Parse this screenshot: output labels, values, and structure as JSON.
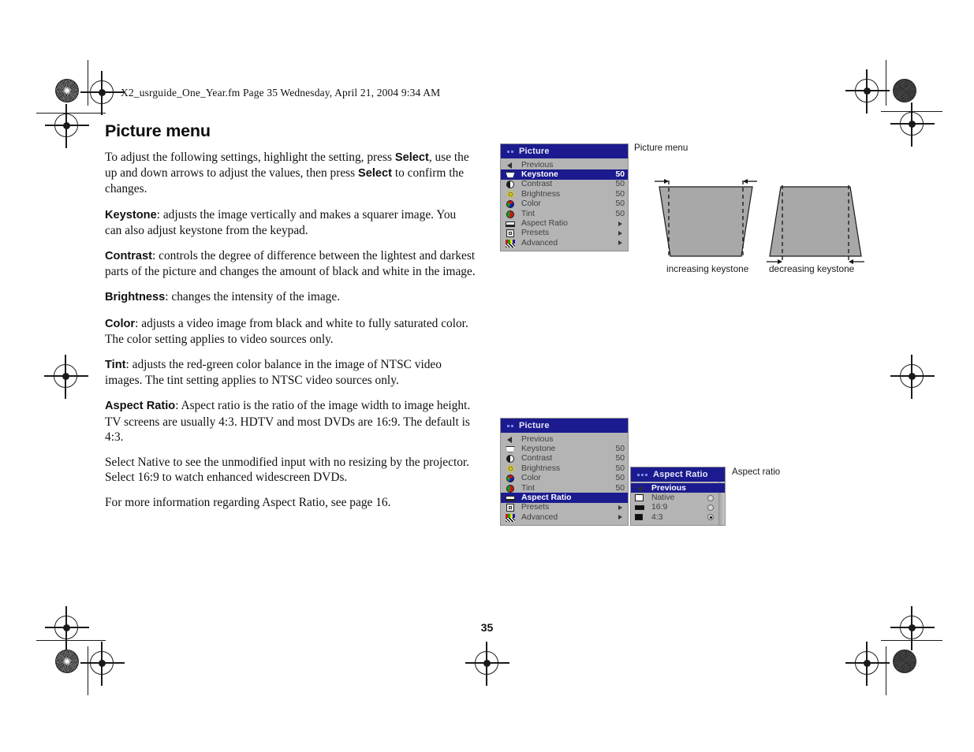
{
  "document": {
    "header_line": "X2_usrguide_One_Year.fm  Page 35  Wednesday, April 21, 2004  9:34 AM",
    "page_number": "35"
  },
  "content": {
    "title": "Picture menu",
    "paragraphs": [
      {
        "lead": "",
        "text": "To adjust the following settings, highlight the setting, press Select, use the up and down arrows to adjust the values, then press Select to confirm the changes."
      },
      {
        "lead": "Keystone",
        "text": ": adjusts the image vertically and makes a squarer image. You can also adjust keystone from the keypad."
      },
      {
        "lead": "Contrast",
        "text": ": controls the degree of difference between the lightest and darkest parts of the picture and changes the amount of black and white in the image."
      },
      {
        "lead": "Brightness",
        "text": ": changes the intensity of the image."
      },
      {
        "lead": "Color",
        "text": ": adjusts a video image from black and white to fully saturated color. The color setting applies to video sources only."
      },
      {
        "lead": "Tint",
        "text": ": adjusts the red-green color balance in the image of NTSC video images. The tint setting applies to NTSC video sources only."
      },
      {
        "lead": "Aspect Ratio",
        "text": ": Aspect ratio is the ratio of the image width to image height. TV screens are usually 4:3. HDTV and most DVDs are 16:9. The default is 4:3."
      },
      {
        "lead": "",
        "text": "Select Native to see the unmodified input with no resizing by the projector. Select 16:9 to watch enhanced widescreen DVDs."
      },
      {
        "lead": "",
        "text": "For more information regarding Aspect Ratio, see page 16."
      }
    ],
    "bold_words_p1": [
      "Select",
      "Select"
    ]
  },
  "colors": {
    "menu_titlebar": "#1b1b8f",
    "menu_background": "#b4b4b4",
    "menu_highlight": "#1b1b8f",
    "menu_text": "#404040",
    "menu_text_selected": "#ffffff",
    "figure_fill": "#a8a8a8",
    "figure_stroke": "#1a1a1a"
  },
  "menu_picture_top": {
    "title": "Picture",
    "rows": [
      {
        "label": "Previous",
        "icon": "previous-arrow-icon",
        "value": "",
        "submenu": false,
        "selected": false
      },
      {
        "label": "Keystone",
        "icon": "keystone-icon",
        "value": "50",
        "submenu": false,
        "selected": true
      },
      {
        "label": "Contrast",
        "icon": "contrast-icon",
        "value": "50",
        "submenu": false,
        "selected": false
      },
      {
        "label": "Brightness",
        "icon": "brightness-icon",
        "value": "50",
        "submenu": false,
        "selected": false
      },
      {
        "label": "Color",
        "icon": "color-icon",
        "value": "50",
        "submenu": false,
        "selected": false
      },
      {
        "label": "Tint",
        "icon": "tint-icon",
        "value": "50",
        "submenu": false,
        "selected": false
      },
      {
        "label": "Aspect Ratio",
        "icon": "aspect-ratio-icon",
        "value": "",
        "submenu": true,
        "selected": false
      },
      {
        "label": "Presets",
        "icon": "presets-icon",
        "value": "",
        "submenu": true,
        "selected": false
      },
      {
        "label": "Advanced",
        "icon": "advanced-icon",
        "value": "",
        "submenu": true,
        "selected": false
      }
    ]
  },
  "menu_picture_bottom": {
    "title": "Picture",
    "rows": [
      {
        "label": "Previous",
        "icon": "previous-arrow-icon",
        "value": "",
        "submenu": false,
        "selected": false
      },
      {
        "label": "Keystone",
        "icon": "keystone-icon",
        "value": "50",
        "submenu": false,
        "selected": false
      },
      {
        "label": "Contrast",
        "icon": "contrast-icon",
        "value": "50",
        "submenu": false,
        "selected": false
      },
      {
        "label": "Brightness",
        "icon": "brightness-icon",
        "value": "50",
        "submenu": false,
        "selected": false
      },
      {
        "label": "Color",
        "icon": "color-icon",
        "value": "50",
        "submenu": false,
        "selected": false
      },
      {
        "label": "Tint",
        "icon": "tint-icon",
        "value": "50",
        "submenu": false,
        "selected": false
      },
      {
        "label": "Aspect Ratio",
        "icon": "aspect-ratio-icon",
        "value": "",
        "submenu": false,
        "selected": true
      },
      {
        "label": "Presets",
        "icon": "presets-icon",
        "value": "",
        "submenu": true,
        "selected": false
      },
      {
        "label": "Advanced",
        "icon": "advanced-icon",
        "value": "",
        "submenu": true,
        "selected": false
      }
    ]
  },
  "menu_aspect_ratio": {
    "title": "Aspect Ratio",
    "previous_label": "Previous",
    "options": [
      {
        "label": "Native",
        "swatch": "native",
        "selected": false
      },
      {
        "label": "16:9",
        "swatch": "w169",
        "selected": false
      },
      {
        "label": "4:3",
        "swatch": "w43",
        "selected": true
      }
    ]
  },
  "callouts": {
    "picture_menu": "Picture menu",
    "aspect_ratio": "Aspect ratio"
  },
  "keystone_figure": {
    "left_caption": "increasing keystone",
    "right_caption": "decreasing keystone"
  }
}
